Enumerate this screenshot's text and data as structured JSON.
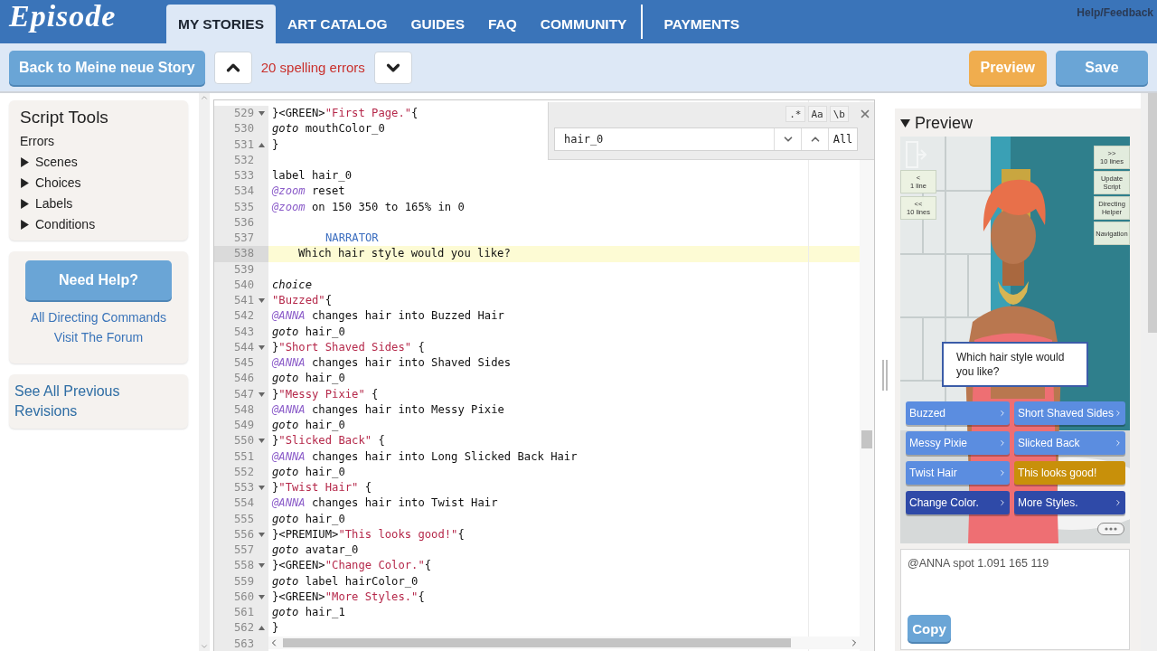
{
  "header": {
    "logo": "Episode",
    "nav": [
      {
        "label": "MY STORIES",
        "selected": true,
        "separator": false
      },
      {
        "label": "ART CATALOG",
        "selected": false,
        "separator": false
      },
      {
        "label": "GUIDES",
        "selected": false,
        "separator": false
      },
      {
        "label": "FAQ",
        "selected": false,
        "separator": false
      },
      {
        "label": "COMMUNITY",
        "selected": false,
        "separator": false
      },
      {
        "label": "PAYMENTS",
        "selected": false,
        "separator": true
      }
    ],
    "help": "Help/Feedback"
  },
  "toolbar": {
    "back": "Back to Meine neue Story",
    "errors": "20 spelling errors",
    "preview": "Preview",
    "save": "Save"
  },
  "sidebar": {
    "title": "Script Tools",
    "errors": "Errors",
    "sections": [
      {
        "label": "Scenes",
        "expanded": false
      },
      {
        "label": "Choices",
        "expanded": false
      },
      {
        "label": "Labels",
        "expanded": false
      },
      {
        "label": "Conditions",
        "expanded": false
      }
    ],
    "help_button": "Need Help?",
    "links": [
      "All Directing Commands",
      "Visit The Forum"
    ],
    "revisions": "See All Previous Revisions"
  },
  "editor": {
    "search": {
      "options": [
        ".*",
        "Aa",
        "\\b"
      ],
      "value": "hair_0",
      "all": "All"
    },
    "lines": [
      {
        "number": "529",
        "fold_start": true,
        "highlighted": false,
        "tokens": [
          {
            "kind": "text",
            "text": "}<GREEN>"
          },
          {
            "kind": "string",
            "text": "\"First Page.\""
          },
          {
            "kind": "text",
            "text": "{"
          }
        ]
      },
      {
        "number": "530",
        "highlighted": false,
        "tokens": [
          {
            "kind": "keyword",
            "text": "goto"
          },
          {
            "kind": "text",
            "text": " mouthColor_0"
          }
        ]
      },
      {
        "number": "531",
        "fold_end": true,
        "highlighted": false,
        "tokens": [
          {
            "kind": "text",
            "text": "}"
          }
        ]
      },
      {
        "number": "532",
        "highlighted": false
      },
      {
        "number": "533",
        "highlighted": false,
        "tokens": [
          {
            "kind": "text",
            "text": "label hair_0"
          }
        ]
      },
      {
        "number": "534",
        "highlighted": false,
        "tokens": [
          {
            "kind": "command",
            "text": "@zoom"
          },
          {
            "kind": "text",
            "text": " reset"
          }
        ]
      },
      {
        "number": "535",
        "highlighted": false,
        "tokens": [
          {
            "kind": "command",
            "text": "@zoom"
          },
          {
            "kind": "text",
            "text": " on 150 350 to 165% in 0"
          }
        ]
      },
      {
        "number": "536",
        "highlighted": false
      },
      {
        "number": "537",
        "kind": "speaker",
        "highlighted": false,
        "tokens": [
          {
            "kind": "character",
            "text": "NARRATOR"
          }
        ]
      },
      {
        "number": "538",
        "kind": "dialogue",
        "highlighted": true,
        "tokens": [
          {
            "kind": "text",
            "text": "Which hair style would you like?"
          }
        ]
      },
      {
        "number": "539",
        "highlighted": false
      },
      {
        "number": "540",
        "highlighted": false,
        "tokens": [
          {
            "kind": "keyword",
            "text": "choice"
          }
        ]
      },
      {
        "number": "541",
        "fold_start": true,
        "highlighted": false,
        "tokens": [
          {
            "kind": "string",
            "text": "\"Buzzed\""
          },
          {
            "kind": "text",
            "text": "{"
          }
        ]
      },
      {
        "number": "542",
        "highlighted": false,
        "tokens": [
          {
            "kind": "command",
            "text": "@ANNA"
          },
          {
            "kind": "text",
            "text": " changes hair into Buzzed Hair"
          }
        ]
      },
      {
        "number": "543",
        "highlighted": false,
        "tokens": [
          {
            "kind": "keyword",
            "text": "goto"
          },
          {
            "kind": "text",
            "text": " hair_0"
          }
        ]
      },
      {
        "number": "544",
        "fold_start": true,
        "highlighted": false,
        "tokens": [
          {
            "kind": "text",
            "text": "}"
          },
          {
            "kind": "string",
            "text": "\"Short Shaved Sides\""
          },
          {
            "kind": "text",
            "text": " {"
          }
        ]
      },
      {
        "number": "545",
        "highlighted": false,
        "tokens": [
          {
            "kind": "command",
            "text": "@ANNA"
          },
          {
            "kind": "text",
            "text": " changes hair into Shaved Sides"
          }
        ]
      },
      {
        "number": "546",
        "highlighted": false,
        "tokens": [
          {
            "kind": "keyword",
            "text": "goto"
          },
          {
            "kind": "text",
            "text": " hair_0"
          }
        ]
      },
      {
        "number": "547",
        "fold_start": true,
        "highlighted": false,
        "tokens": [
          {
            "kind": "text",
            "text": "}"
          },
          {
            "kind": "string",
            "text": "\"Messy Pixie\""
          },
          {
            "kind": "text",
            "text": " {"
          }
        ]
      },
      {
        "number": "548",
        "highlighted": false,
        "tokens": [
          {
            "kind": "command",
            "text": "@ANNA"
          },
          {
            "kind": "text",
            "text": " changes hair into Messy Pixie"
          }
        ]
      },
      {
        "number": "549",
        "highlighted": false,
        "tokens": [
          {
            "kind": "keyword",
            "text": "goto"
          },
          {
            "kind": "text",
            "text": " hair_0"
          }
        ]
      },
      {
        "number": "550",
        "fold_start": true,
        "highlighted": false,
        "tokens": [
          {
            "kind": "text",
            "text": "}"
          },
          {
            "kind": "string",
            "text": "\"Slicked Back\""
          },
          {
            "kind": "text",
            "text": " {"
          }
        ]
      },
      {
        "number": "551",
        "highlighted": false,
        "tokens": [
          {
            "kind": "command",
            "text": "@ANNA"
          },
          {
            "kind": "text",
            "text": " changes hair into Long Slicked Back Hair"
          }
        ]
      },
      {
        "number": "552",
        "highlighted": false,
        "tokens": [
          {
            "kind": "keyword",
            "text": "goto"
          },
          {
            "kind": "text",
            "text": " hair_0"
          }
        ]
      },
      {
        "number": "553",
        "fold_start": true,
        "highlighted": false,
        "tokens": [
          {
            "kind": "text",
            "text": "}"
          },
          {
            "kind": "string",
            "text": "\"Twist Hair\""
          },
          {
            "kind": "text",
            "text": " {"
          }
        ]
      },
      {
        "number": "554",
        "highlighted": false,
        "tokens": [
          {
            "kind": "command",
            "text": "@ANNA"
          },
          {
            "kind": "text",
            "text": " changes hair into Twist Hair"
          }
        ]
      },
      {
        "number": "555",
        "highlighted": false,
        "tokens": [
          {
            "kind": "keyword",
            "text": "goto"
          },
          {
            "kind": "text",
            "text": " hair_0"
          }
        ]
      },
      {
        "number": "556",
        "fold_start": true,
        "highlighted": false,
        "tokens": [
          {
            "kind": "text",
            "text": "}<PREMIUM>"
          },
          {
            "kind": "string",
            "text": "\"This looks good!\""
          },
          {
            "kind": "text",
            "text": "{"
          }
        ]
      },
      {
        "number": "557",
        "highlighted": false,
        "tokens": [
          {
            "kind": "keyword",
            "text": "goto"
          },
          {
            "kind": "text",
            "text": " avatar_0"
          }
        ]
      },
      {
        "number": "558",
        "fold_start": true,
        "highlighted": false,
        "tokens": [
          {
            "kind": "text",
            "text": "}<GREEN>"
          },
          {
            "kind": "string",
            "text": "\"Change Color.\""
          },
          {
            "kind": "text",
            "text": "{"
          }
        ]
      },
      {
        "number": "559",
        "highlighted": false,
        "tokens": [
          {
            "kind": "keyword",
            "text": "goto"
          },
          {
            "kind": "text",
            "text": " label hairColor_0"
          }
        ]
      },
      {
        "number": "560",
        "fold_start": true,
        "highlighted": false,
        "tokens": [
          {
            "kind": "text",
            "text": "}<GREEN>"
          },
          {
            "kind": "string",
            "text": "\"More Styles.\""
          },
          {
            "kind": "text",
            "text": "{"
          }
        ]
      },
      {
        "number": "561",
        "highlighted": false,
        "tokens": [
          {
            "kind": "keyword",
            "text": "goto"
          },
          {
            "kind": "text",
            "text": " hair_1"
          }
        ]
      },
      {
        "number": "562",
        "fold_end": true,
        "highlighted": false,
        "tokens": [
          {
            "kind": "text",
            "text": "}"
          }
        ]
      },
      {
        "number": "563",
        "highlighted": false
      }
    ]
  },
  "preview": {
    "title": "Preview",
    "expanded": true,
    "left_controls": [
      "<\n1 line",
      "<<\n10 lines"
    ],
    "right_controls": [
      ">>\n10 lines",
      "Update\nScript",
      "Directing\nHelper",
      "Navigation"
    ],
    "dialogue": "Which hair style would you like?",
    "choices": [
      {
        "label": "Buzzed",
        "color": "#5b8de0",
        "arrow": true
      },
      {
        "label": "Short Shaved Sides",
        "color": "#5b8de0",
        "arrow": true
      },
      {
        "label": "Messy Pixie",
        "color": "#5b8de0",
        "arrow": true
      },
      {
        "label": "Slicked Back",
        "color": "#5b8de0",
        "arrow": true
      },
      {
        "label": "Twist Hair",
        "color": "#5b8de0",
        "arrow": true
      },
      {
        "label": "This looks good!",
        "color": "#c8900a",
        "arrow": false
      },
      {
        "label": "Change Color.",
        "color": "#2f4aa8",
        "arrow": true
      },
      {
        "label": "More Styles.",
        "color": "#2f4aa8",
        "arrow": true
      }
    ],
    "command": "@ANNA spot 1.091 165 119",
    "copy": "Copy"
  }
}
